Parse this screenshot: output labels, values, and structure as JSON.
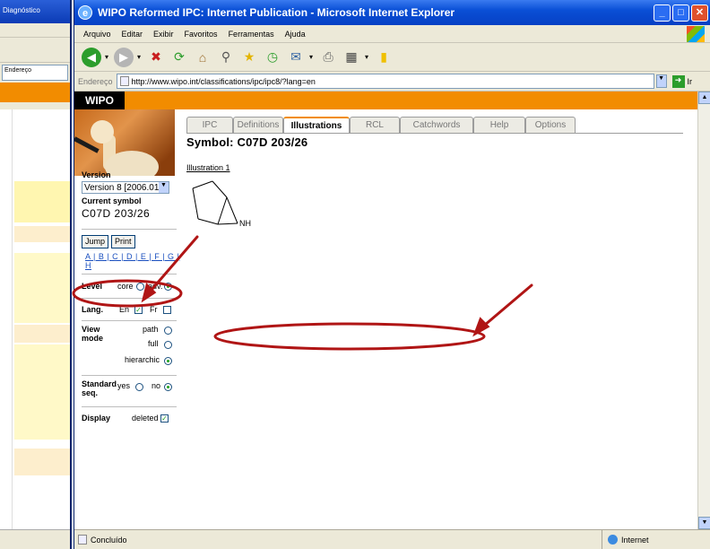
{
  "browser": {
    "title": "WIPO Reformed IPC: Internet Publication - Microsoft Internet Explorer",
    "menu": [
      "Arquivo",
      "Editar",
      "Exibir",
      "Favoritos",
      "Ferramentas",
      "Ajuda"
    ],
    "address_label": "Endereço",
    "address": "http://www.wipo.int/classifications/ipc/ipc8/?lang=en",
    "go_label": "Ir",
    "status_text": "Concluído",
    "zone_text": "Internet"
  },
  "background_window": {
    "title": "Diagnóstico",
    "address": "Endereço"
  },
  "page": {
    "brand": "WIPO",
    "tabs": [
      "IPC",
      "Definitions",
      "Illustrations",
      "RCL",
      "Catchwords",
      "Help",
      "Options"
    ],
    "active_tab": "Illustrations",
    "symbol_title": "Symbol: C07D 203/26",
    "illustration_label": "Illustration 1",
    "structure_label": "NH",
    "form": {
      "version_label": "Version",
      "version_value": "Version 8 [2006.01]",
      "current_symbol_label": "Current symbol",
      "current_symbol": "C07D 203/26",
      "jump_label": "Jump",
      "print_label": "Print",
      "letters": "A | B | C | D | E | F | G | H",
      "level_label": "Level",
      "level_core": "core",
      "level_adv": "adv.",
      "lang_label": "Lang.",
      "lang_en": "En",
      "lang_fr": "Fr",
      "view_mode_label": "View mode",
      "view_path": "path",
      "view_full": "full",
      "view_hier": "hierarchic",
      "std_seq_label": "Standard seq.",
      "std_yes": "yes",
      "std_no": "no",
      "display_label": "Display",
      "display_deleted": "deleted"
    }
  },
  "annotation_color": "#b01515"
}
